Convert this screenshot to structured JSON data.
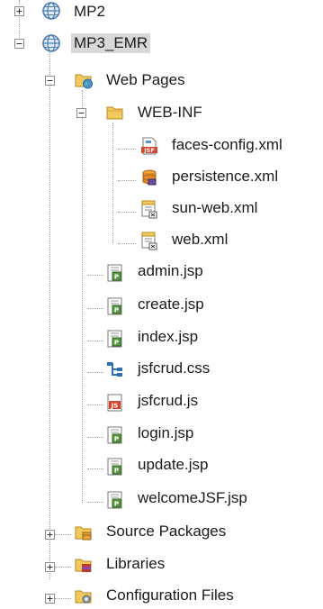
{
  "project_tree": {
    "nodes": [
      {
        "label": "MP2",
        "icon": "project-globe-icon",
        "expander": "plus",
        "selected": false
      },
      {
        "label": "MP3_EMR",
        "icon": "project-globe-icon",
        "expander": "minus",
        "selected": true
      },
      {
        "label": "Web Pages",
        "icon": "web-pages-folder-icon",
        "expander": "minus",
        "selected": false
      },
      {
        "label": "WEB-INF",
        "icon": "folder-icon",
        "expander": "minus",
        "selected": false
      },
      {
        "label": "faces-config.xml",
        "icon": "jsf-config-file-icon",
        "expander": "none",
        "selected": false
      },
      {
        "label": "persistence.xml",
        "icon": "persistence-file-icon",
        "expander": "none",
        "selected": false
      },
      {
        "label": "sun-web.xml",
        "icon": "xml-descriptor-file-icon",
        "expander": "none",
        "selected": false
      },
      {
        "label": "web.xml",
        "icon": "xml-descriptor-file-icon",
        "expander": "none",
        "selected": false
      },
      {
        "label": "admin.jsp",
        "icon": "jsp-file-icon",
        "expander": "none",
        "selected": false
      },
      {
        "label": "create.jsp",
        "icon": "jsp-file-icon",
        "expander": "none",
        "selected": false
      },
      {
        "label": "index.jsp",
        "icon": "jsp-file-icon",
        "expander": "none",
        "selected": false
      },
      {
        "label": "jsfcrud.css",
        "icon": "css-file-icon",
        "expander": "none",
        "selected": false
      },
      {
        "label": "jsfcrud.js",
        "icon": "js-file-icon",
        "expander": "none",
        "selected": false
      },
      {
        "label": "login.jsp",
        "icon": "jsp-file-icon",
        "expander": "none",
        "selected": false
      },
      {
        "label": "update.jsp",
        "icon": "jsp-file-icon",
        "expander": "none",
        "selected": false
      },
      {
        "label": "welcomeJSF.jsp",
        "icon": "jsp-file-icon",
        "expander": "none",
        "selected": false
      },
      {
        "label": "Source Packages",
        "icon": "source-packages-icon",
        "expander": "plus",
        "selected": false
      },
      {
        "label": "Libraries",
        "icon": "libraries-icon",
        "expander": "plus",
        "selected": false
      },
      {
        "label": "Configuration Files",
        "icon": "configuration-files-icon",
        "expander": "plus",
        "selected": false
      }
    ]
  },
  "colors": {
    "selection_bg": "#d9d9d9",
    "folder_yellow": "#e8b84a",
    "globe_blue": "#4d7fb5",
    "jsp_green": "#4f8a3c",
    "js_red": "#c8412b",
    "guide_line": "#a0a0a0"
  }
}
